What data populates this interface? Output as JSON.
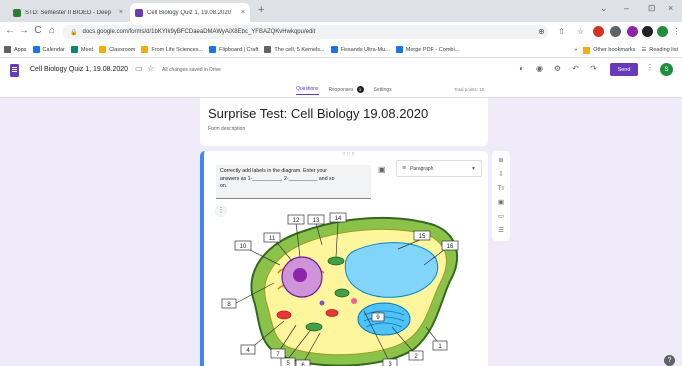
{
  "browser": {
    "tabs": [
      {
        "title": "STD: Semester II BIOED - Deep",
        "close": "×",
        "favicon_color": "#2e7d32"
      },
      {
        "title": "Cell Biology Quiz 1, 19.08.2020",
        "close": "×",
        "favicon_color": "#673ab7"
      }
    ],
    "new_tab": "+",
    "window_controls": [
      "⌄",
      "–",
      "⊡",
      "×"
    ],
    "nav": [
      "←",
      "→",
      "C",
      "⌂"
    ],
    "url": "docs.google.com/forms/d/1bKYIk9yBFCDaeaDMAWyAiX8Ebc_YFBAZQKvHwkqpu/edit",
    "toolbar_icons": [
      "⊕",
      "⇧",
      "☆"
    ],
    "bookmarks": [
      {
        "label": "Apps",
        "color": "#5f6368"
      },
      {
        "label": "Calendar",
        "color": "#1a73e8"
      },
      {
        "label": "Meet",
        "color": "#00897b"
      },
      {
        "label": "Classroom",
        "color": "#f9ab00"
      },
      {
        "label": "From Life Sciences...",
        "color": "#f9ab00"
      },
      {
        "label": "Flipboard | Craft",
        "color": "#1a73e8"
      },
      {
        "label": "The cell, 5 Kernels...",
        "color": "#5f6368"
      },
      {
        "label": "Fissands Ultra-Mu...",
        "color": "#1a73e8"
      },
      {
        "label": "Merge PDF - Combi...",
        "color": "#1a73e8"
      }
    ],
    "other_bookmarks": "Other bookmarks",
    "reading_list": "Reading list"
  },
  "form_header": {
    "title": "Cell Biology Quiz 1, 19.08.2020",
    "saved": "All changes saved in Drive",
    "tabs": [
      {
        "label": "Questions",
        "active": true
      },
      {
        "label": "Responses",
        "badge": "3",
        "active": false
      },
      {
        "label": "Settings",
        "active": false
      }
    ],
    "total_points": "Total points: 15",
    "send_label": "Send",
    "avatar_initial": "S"
  },
  "title_card": {
    "title": "Surprise Test: Cell Biology 19.08.2020",
    "description": "Form description"
  },
  "question": {
    "text_line1": "Correctly add labels in the diagram. Enter your",
    "text_line2": "answers as 1-__________, 2-__________ and so",
    "text_line3": "on.",
    "type_label": "Paragraph",
    "drag_handle": "⠿⠿⠿",
    "diagram_labels": [
      "1",
      "2",
      "3",
      "4",
      "5",
      "6",
      "7",
      "8",
      "9",
      "10",
      "11",
      "12",
      "13",
      "14",
      "15",
      "16"
    ]
  },
  "side_toolbar": [
    "⊕",
    "⇩",
    "Tт",
    "▣",
    "▭",
    "☰"
  ],
  "help": "?"
}
